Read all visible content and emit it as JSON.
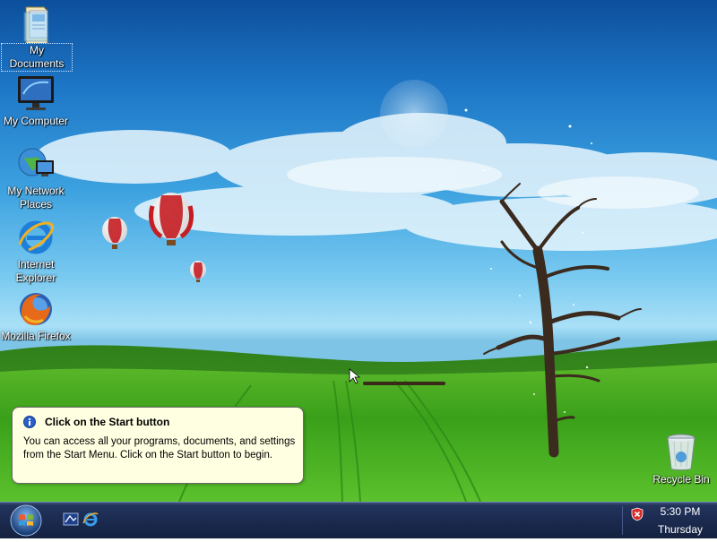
{
  "desktop_icons": [
    {
      "label": "My Documents",
      "icon": "folder-documents-icon"
    },
    {
      "label": "My Computer",
      "icon": "monitor-icon"
    },
    {
      "label": "My Network Places",
      "icon": "network-globe-icon"
    },
    {
      "label": "Internet Explorer",
      "icon": "internet-explorer-icon"
    },
    {
      "label": "Mozilla Firefox",
      "icon": "firefox-icon"
    },
    {
      "label": "Recycle Bin",
      "icon": "recycle-bin-icon"
    }
  ],
  "balloon": {
    "title": "Click on the Start button",
    "text": "You can access all your programs, documents, and settings from the Start Menu. Click on the Start button to begin.",
    "icon": "info-icon"
  },
  "taskbar": {
    "start_icon": "windows-start-orb-icon",
    "quick_launch": [
      "show-desktop-icon",
      "internet-explorer-icon"
    ],
    "tray_icon": "security-shield-icon",
    "clock_time": "5:30 PM",
    "clock_day": "Thursday"
  },
  "colors": {
    "taskbar": "#1b2a4f",
    "balloon_bg": "#ffffe1",
    "sky_top": "#0c4f9c",
    "grass": "#3da21c"
  }
}
